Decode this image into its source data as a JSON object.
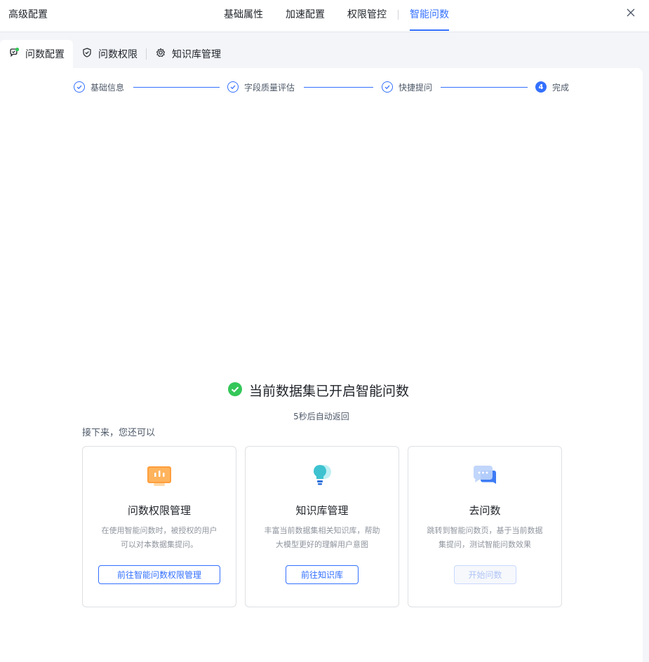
{
  "header": {
    "title": "高级配置",
    "tabs": [
      {
        "label": "基础属性",
        "active": false
      },
      {
        "label": "加速配置",
        "active": false
      },
      {
        "label": "权限管控",
        "active": false
      },
      {
        "label": "智能问数",
        "active": true
      }
    ]
  },
  "subtabs": [
    {
      "label": "问数配置",
      "icon": "chat-config-icon",
      "active": true
    },
    {
      "label": "问数权限",
      "icon": "shield-icon",
      "active": false
    },
    {
      "label": "知识库管理",
      "icon": "knowledge-base-icon",
      "active": false
    }
  ],
  "steps": [
    {
      "label": "基础信息",
      "status": "done"
    },
    {
      "label": "字段质量评估",
      "status": "done"
    },
    {
      "label": "快捷提问",
      "status": "done"
    },
    {
      "label": "完成",
      "number": "4",
      "status": "current"
    }
  ],
  "result": {
    "title": "当前数据集已开启智能问数",
    "countdown": "5秒后自动返回",
    "next_label": "接下来，您还可以"
  },
  "cards": [
    {
      "icon": "permission-monitor-icon",
      "title": "问数权限管理",
      "desc": "在使用智能问数时，被授权的用户可以对本数据集提问。",
      "button": "前往智能问数权限管理",
      "disabled": false
    },
    {
      "icon": "lightbulb-icon",
      "title": "知识库管理",
      "desc": "丰富当前数据集相关知识库，帮助大模型更好的理解用户意图",
      "button": "前往知识库",
      "disabled": false
    },
    {
      "icon": "chat-bubble-icon",
      "title": "去问数",
      "desc": "跳转到智能问数页，基于当前数据集提问，测试智能问数效果",
      "button": "开始问数",
      "disabled": true
    }
  ],
  "colors": {
    "accent": "#3370ff",
    "success": "#34c759",
    "orange": "#ff9e3d",
    "teal": "#3ec2d0"
  }
}
